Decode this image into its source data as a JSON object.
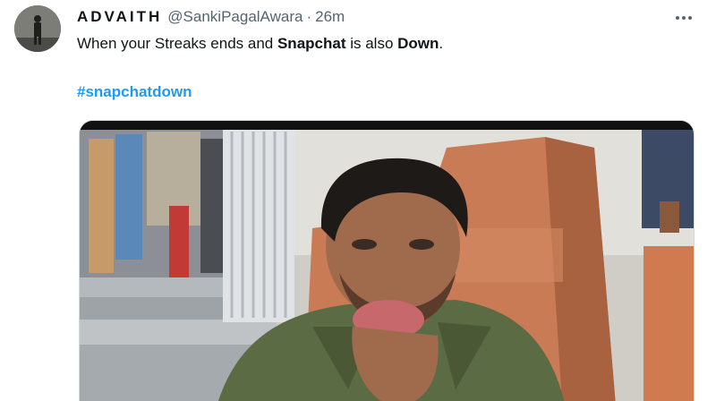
{
  "tweet": {
    "display_name": "ADVAITH",
    "handle": "@SankiPagalAwara",
    "separator": "·",
    "time": "26m",
    "more_icon": "more-horizontal-icon",
    "text_parts": {
      "p1": "When your Streaks ends and ",
      "b1": "Snapchat",
      "p2": " is also ",
      "b2": "Down",
      "p3": "."
    },
    "hashtag": "#snapchatdown",
    "colors": {
      "link": "#1d9bf0",
      "secondary": "#536471",
      "text": "#0f1419"
    }
  }
}
